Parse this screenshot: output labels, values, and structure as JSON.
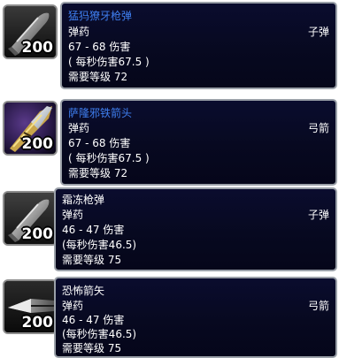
{
  "stack_count": "200",
  "colors": {
    "item_name_rare": "#3f7ff0",
    "item_name_common": "#ffffff",
    "tooltip_bg": "#070920",
    "tooltip_border": "#9aa0a8"
  },
  "items": [
    {
      "name": "猛犸獠牙枪弹",
      "name_color": "blue",
      "icon": "bullet-icon",
      "type": "弹药",
      "subtype": "子弹",
      "damage": "67 - 68 伤害",
      "dps": "( 每秒伤害67.5 )",
      "required_level": "需要等级 72"
    },
    {
      "name": "萨隆邪铁箭头",
      "name_color": "blue",
      "icon": "arrow-icon",
      "type": "弹药",
      "subtype": "弓箭",
      "damage": "67 - 68 伤害",
      "dps": "( 每秒伤害67.5 )",
      "required_level": "需要等级 72"
    },
    {
      "name": "霜冻枪弹",
      "name_color": "white",
      "icon": "bullet-icon",
      "type": "弹药",
      "subtype": "子弹",
      "damage": "46 - 47 伤害",
      "dps": "(每秒伤害46.5)",
      "required_level": "需要等级 75"
    },
    {
      "name": "恐怖箭矢",
      "name_color": "white",
      "icon": "arrowhead-icon",
      "type": "弹药",
      "subtype": "弓箭",
      "damage": "46 - 47 伤害",
      "dps": "(每秒伤害46.5)",
      "required_level": "需要等级 75"
    }
  ]
}
